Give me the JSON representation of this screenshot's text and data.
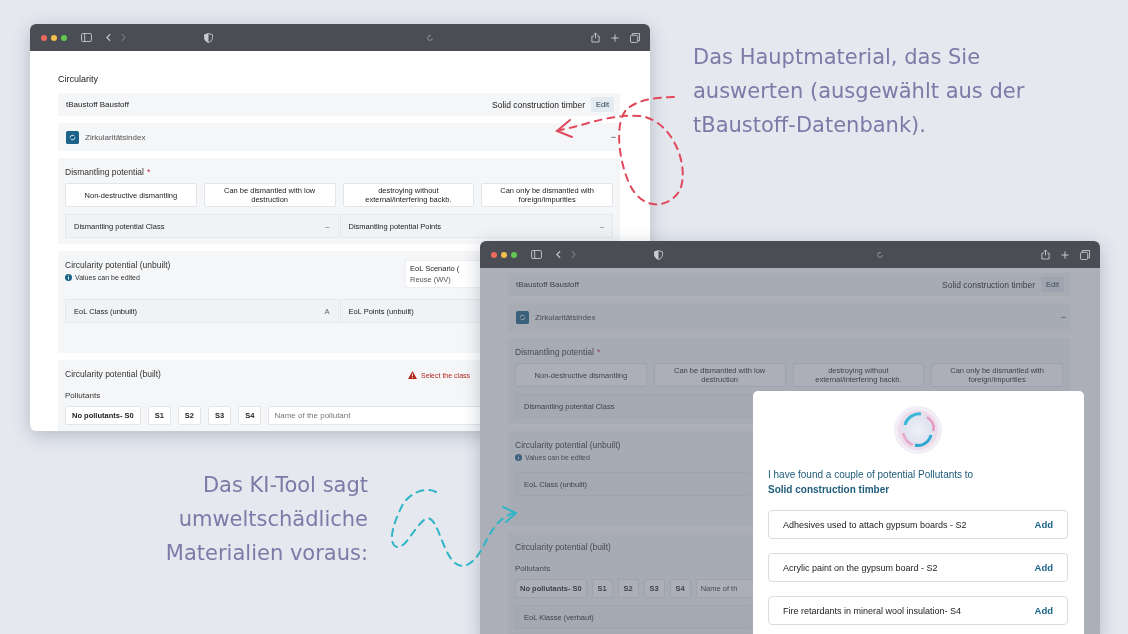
{
  "annotations": [
    {
      "kind": "top",
      "lines": [
        "Das Hauptmaterial, das Sie",
        "auswerten (ausgewählt aus der",
        "tBaustoff-Datenbank)."
      ]
    },
    {
      "kind": "bottom",
      "lines": [
        "Das KI-Tool sagt",
        "umweltschädliche",
        "Materialien voraus:"
      ]
    }
  ],
  "back_window": {
    "sections": [
      {
        "kind": "heading",
        "text": "Circularity"
      },
      {
        "kind": "material",
        "label": "tBaustoff Baustoff",
        "value": "Solid construction timber",
        "button": "Edit"
      },
      {
        "kind": "index",
        "label": "Zirkularitätsindex",
        "toggle": "−"
      },
      {
        "kind": "dismantling",
        "title": "Dismantling potential",
        "required_mark": "*",
        "options": [
          "Non-destructive dismantling",
          "Can be dismantled with low destruction",
          "destroying without external/interfering backb.",
          "Can only be dismantled with foreign/impurities"
        ],
        "fields": [
          {
            "label": "Dismantling potential Class",
            "value": "–"
          },
          {
            "label": "Dismantling potential Points",
            "value": "–"
          }
        ]
      },
      {
        "kind": "unbuilt",
        "title": "Circularity potential (unbuilt)",
        "note": "Values can be edited",
        "scenario": {
          "label": "EoL Scenario (",
          "value": "Reuse (WV)"
        },
        "fields": [
          {
            "label": "EoL Class (unbuilt)",
            "value": "A"
          },
          {
            "label": "EoL Points (unbuilt)"
          }
        ]
      },
      {
        "kind": "built",
        "title": "Circularity potential (built)",
        "warning": "Select the class",
        "pollutants_label": "Pollutants",
        "chips": [
          "No pollutants- S0",
          "S1",
          "S2",
          "S3",
          "S4"
        ],
        "name_field": {
          "placeholder": "Name of the pollutant"
        }
      }
    ]
  },
  "front_window": {
    "sections": [
      {
        "kind": "material",
        "label": "tBaustoff Baustoff",
        "value": "Solid construction timber",
        "button": "Edit"
      },
      {
        "kind": "index",
        "label": "Zirkularitätsindex",
        "toggle": "−"
      },
      {
        "kind": "dismantling",
        "title": "Dismantling potential",
        "required_mark": "*",
        "options": [
          "Non-destructive dismantling",
          "Can be dismantled with low destruction",
          "destroying without external/interfering backb.",
          "Can only be dismantled with foreign/impurities"
        ],
        "fields": [
          {
            "label": "Dismantling potential Class"
          }
        ]
      },
      {
        "kind": "unbuilt",
        "title": "Circularity potential (unbuilt)",
        "note": "Values can be edited",
        "fields": [
          {
            "label": "EoL Class (unbuilt)"
          }
        ]
      },
      {
        "kind": "built",
        "title": "Circularity potential (built)",
        "pollutants_label": "Pollutants",
        "chips": [
          "No pollutants- S0",
          "S1",
          "S2",
          "S3",
          "S4"
        ],
        "name_field": {
          "placeholder": "Name of th"
        },
        "fields": [
          {
            "label": "EoL Klasse (verbaut)"
          }
        ]
      }
    ],
    "dialog": {
      "message": "I have found a couple of potential Pollutants to **Solid construction timber**",
      "suggestions": [
        {
          "text": "Adhesives used to attach gypsum boards - S2",
          "action": "Add"
        },
        {
          "text": "Acrylic paint on the gypsum board - S2",
          "action": "Add"
        },
        {
          "text": "Fire retardants in mineral wool insulation- S4",
          "action": "Add"
        }
      ]
    }
  }
}
